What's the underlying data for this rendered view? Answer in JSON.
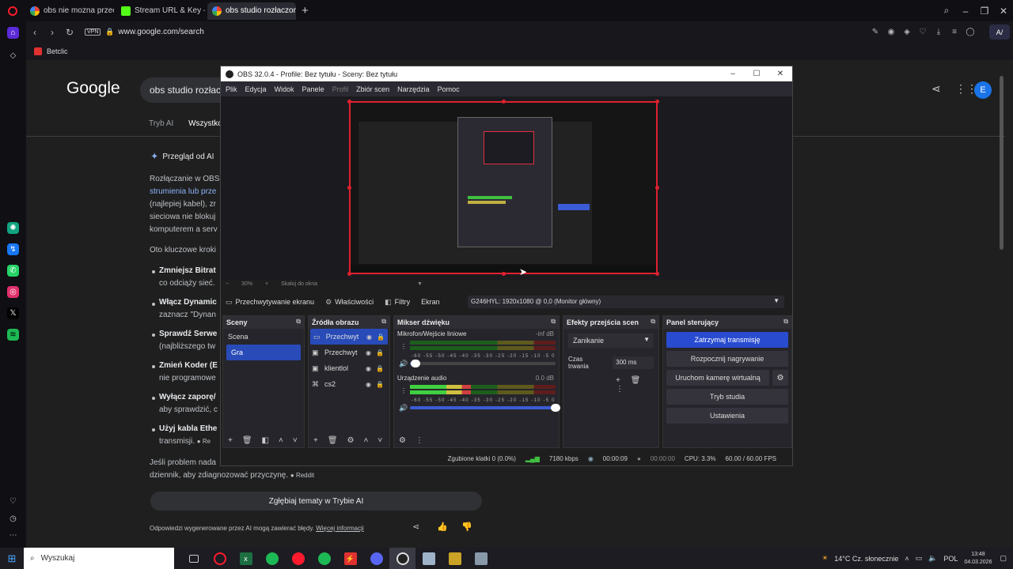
{
  "browser": {
    "tabs": [
      {
        "label": "obs nie mozna przechwyc",
        "icon": "google-icon",
        "active": false
      },
      {
        "label": "Stream URL & Key - Kick D",
        "icon": "kick-icon",
        "active": false
      },
      {
        "label": "obs studio rozłaczony - S",
        "icon": "google-icon",
        "active": true
      }
    ],
    "new_tab": "+",
    "url": "www.google.com/search",
    "vpn": "VPN",
    "aria": "A/",
    "bookmark": "Betclic"
  },
  "google": {
    "logo": "Google",
    "search_value": "obs studio rozłaczo",
    "tabs": [
      "Tryb AI",
      "Wszystko"
    ],
    "avatar": "E",
    "ai_overview": "Przegląd od AI",
    "paragraph": [
      "Rozłączanie w OBS",
      "strumienia lub prze",
      "(najlepiej kabel), zr",
      "sieciowa nie blokuj",
      "komputerem a serv"
    ],
    "intro": "Oto kluczowe kroki",
    "bullets": [
      {
        "title": "Zmniejsz Bitrat",
        "sub": "co odciąży sieć."
      },
      {
        "title": "Włącz Dynamic",
        "sub": "zaznacz \"Dynan"
      },
      {
        "title": "Sprawdź Serwe",
        "sub": "(najbliższego tw"
      },
      {
        "title": "Zmień Koder (E",
        "sub": "nie programowe"
      },
      {
        "title": "Wyłącz zaporę/",
        "sub": "aby sprawdzić, c"
      },
      {
        "title": "Użyj kabla Ethe",
        "sub": "transmisji."
      }
    ],
    "reddit_tag": "Re",
    "closing_1": "Jeśli problem nada",
    "closing_2": "dziennik, aby zdiagnozować przyczynę.",
    "reddit_label": "Reddit",
    "deep_button": "Zgłębiaj tematy w Trybie AI",
    "footer": "Odpowiedzi wygenerowane przez AI mogą zawierać błędy.",
    "footer_link": "Więcej informacji"
  },
  "obs": {
    "title": "OBS 32.0.4 - Profile: Bez tytułu - Sceny: Bez tytułu",
    "menu": [
      "Plik",
      "Edycja",
      "Widok",
      "Panele",
      "Profil",
      "Zbiór scen",
      "Narzędzia",
      "Pomoc"
    ],
    "zoom": "30%",
    "zoom_minus": "−",
    "zoom_mode": "Skaluj do okna",
    "source_label": "Przechwytywanie ekranu",
    "properties": "Właściwości",
    "filters": "Filtry",
    "screen_label": "Ekran",
    "screen_value": "G246HYL: 1920x1080 @ 0,0 (Monitor główny)",
    "docks": {
      "scenes": "Sceny",
      "sources": "Źródła obrazu",
      "mixer": "Mikser dźwięku",
      "transitions": "Efekty przejścia scen",
      "controls": "Panel sterujący"
    },
    "scenes": [
      "Scena",
      "Gra"
    ],
    "sources": [
      {
        "name": "Przechwyt",
        "icon": "monitor-icon"
      },
      {
        "name": "Przechwyt",
        "icon": "window-icon"
      },
      {
        "name": "klientlol",
        "icon": "window-icon"
      },
      {
        "name": "cs2",
        "icon": "gamepad-icon"
      }
    ],
    "mixer": [
      {
        "name": "Mikrofon/Wejście liniowe",
        "db": "-inf dB",
        "level": 0.0,
        "volume": 0.04
      },
      {
        "name": "Urządzenie audio",
        "db": "0.0 dB",
        "level": 0.42,
        "volume": 1.0
      }
    ],
    "meter_scale": "-60 -55 -50 -45 -40 -35 -30 -25 -20 -15 -10 -5 0",
    "transition_type": "Zanikanie",
    "duration_label": "Czas trwania",
    "duration_value": "300 ms",
    "controls": {
      "stop_stream": "Zatrzymaj transmisję",
      "start_record": "Rozpocznij nagrywanie",
      "virtual_cam": "Uruchom kamerę wirtualną",
      "studio_mode": "Tryb studia",
      "settings": "Ustawienia"
    },
    "status": {
      "dropped": "Zgubione klatki 0 (0.0%)",
      "bitrate": "7180 kbps",
      "stream_time": "00:00:09",
      "record_time": "00:00:00",
      "cpu": "CPU: 3.3%",
      "fps": "60.00 / 60.00 FPS"
    }
  },
  "taskbar": {
    "search": "Wyszukaj",
    "weather": "14°C  Cz. słonecznie",
    "lang": "POL",
    "time": "13:48",
    "date": "04.03.2026"
  },
  "colors": {
    "accent": "#284bd0",
    "obs_red": "#e02030",
    "opera_red": "#ff1b2d"
  }
}
